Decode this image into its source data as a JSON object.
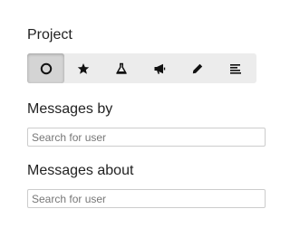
{
  "project": {
    "label": "Project",
    "icons": [
      {
        "name": "circle-icon",
        "active": true
      },
      {
        "name": "star-icon",
        "active": false
      },
      {
        "name": "flask-icon",
        "active": false
      },
      {
        "name": "megaphone-icon",
        "active": false
      },
      {
        "name": "pencil-icon",
        "active": false
      },
      {
        "name": "align-left-icon",
        "active": false
      }
    ]
  },
  "messages_by": {
    "label": "Messages by",
    "placeholder": "Search for user",
    "value": ""
  },
  "messages_about": {
    "label": "Messages about",
    "placeholder": "Search for user",
    "value": ""
  },
  "colors": {
    "bar_background": "#ececec",
    "active_button": "#d4d4d4",
    "icon": "#111111",
    "input_border": "#cccccc"
  }
}
